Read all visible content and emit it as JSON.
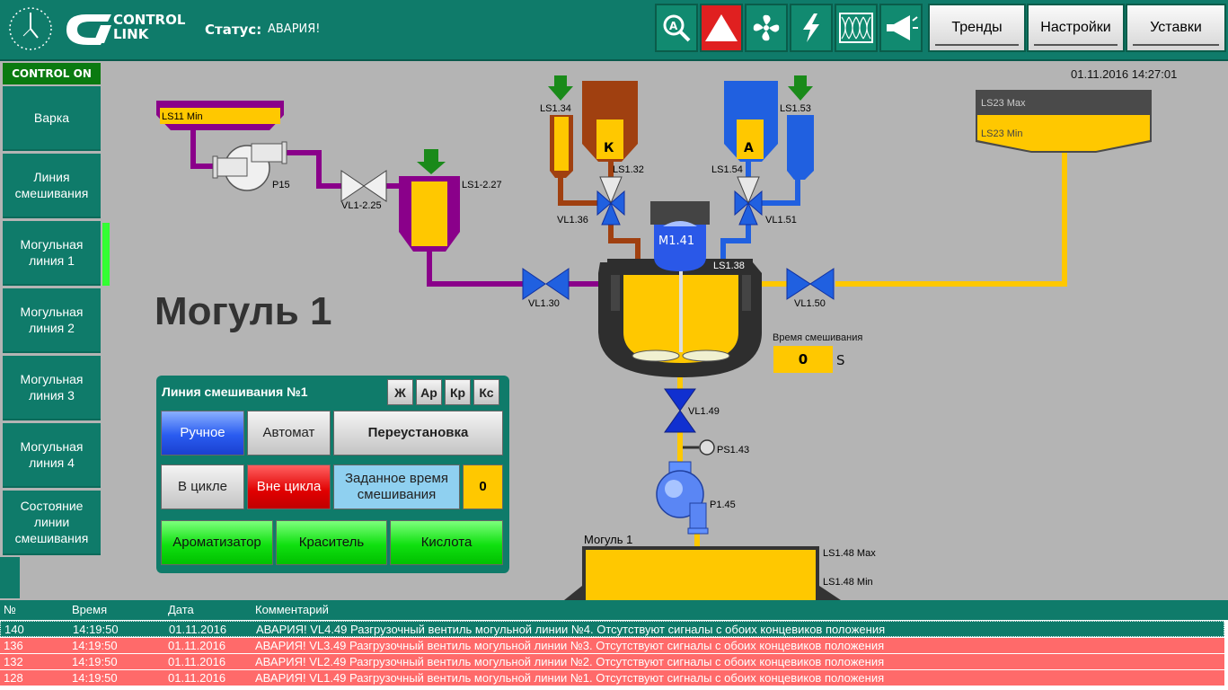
{
  "header": {
    "logo_line1": "CONTROL",
    "logo_line2": "LINK",
    "status_label": "Статус:",
    "status_value": "АВАРИЯ!",
    "icons": [
      "search-zoom-icon",
      "alarm-warning-icon",
      "fan-icon",
      "lightning-icon",
      "pattern-icon",
      "horn-icon"
    ],
    "buttons": {
      "trends": "Тренды",
      "settings": "Настройки",
      "setpoints": "Уставки"
    }
  },
  "sidebar": {
    "header": "CONTROL ON",
    "items": [
      {
        "label": "Варка"
      },
      {
        "label": "Линия смешивания"
      },
      {
        "label": "Могульная линия 1"
      },
      {
        "label": "Могульная линия 2"
      },
      {
        "label": "Могульная линия 3"
      },
      {
        "label": "Могульная линия 4"
      },
      {
        "label": "Состояние линии смешивания"
      }
    ],
    "active_index": 2
  },
  "datetime": "01.11.2016 14:27:01",
  "page_title": "Могуль 1",
  "process": {
    "ls11": "LS11 Min",
    "p15": "P15",
    "vl1_225": "VL1-2.25",
    "ls1_227": "LS1-2.27",
    "ls1_34": "LS1.34",
    "k_letter": "К",
    "ls1_32": "LS1.32",
    "vl1_36": "VL1.36",
    "a_letter": "А",
    "ls1_54": "LS1.54",
    "ls1_53": "LS1.53",
    "vl1_51": "VL1.51",
    "m141": "M1.41",
    "ls1_38": "LS1.38",
    "vl1_30": "VL1.30",
    "vl1_50": "VL1.50",
    "ls23_max": "LS23 Max",
    "ls23_min": "LS23 Min",
    "vl1_49": "VL1.49",
    "ps1_43": "PS1.43",
    "p1_45": "P1.45",
    "mogul_label": "Могуль 1",
    "ls1_48_max": "LS1.48 Max",
    "ls1_48_min": "LS1.48 Min",
    "mix_time_label": "Время смешивания",
    "mix_time_value": "0",
    "mix_time_unit": "S"
  },
  "panel": {
    "title": "Линия смешивания №1",
    "tags": [
      "Ж",
      "Ар",
      "Кр",
      "Кс"
    ],
    "manual": "Ручное",
    "auto": "Автомат",
    "reset": "Переустановка",
    "in_cycle": "В цикле",
    "out_cycle": "Вне цикла",
    "set_time": "Заданное время смешивания",
    "set_time_value": "0",
    "aroma": "Ароматизатор",
    "dye": "Краситель",
    "acid": "Кислота"
  },
  "alarms": {
    "columns": [
      "№",
      "Время",
      "Дата",
      "Комментарий"
    ],
    "rows": [
      {
        "num": "140",
        "time": "14:19:50",
        "date": "01.11.2016",
        "comment": "АВАРИЯ! VL4.49 Разгрузочный вентиль могульной линии №4. Отсутствуют сигналы с обоих концевиков положения"
      },
      {
        "num": "136",
        "time": "14:19:50",
        "date": "01.11.2016",
        "comment": "АВАРИЯ! VL3.49 Разгрузочный вентиль могульной линии №3. Отсутствуют сигналы с обоих концевиков положения"
      },
      {
        "num": "132",
        "time": "14:19:50",
        "date": "01.11.2016",
        "comment": "АВАРИЯ! VL2.49 Разгрузочный вентиль могульной линии №2. Отсутствуют сигналы с обоих концевиков положения"
      },
      {
        "num": "128",
        "time": "14:19:50",
        "date": "01.11.2016",
        "comment": "АВАРИЯ! VL1.49 Разгрузочный вентиль могульной линии №1. Отсутствуют сигналы с обоих концевиков положения"
      }
    ]
  },
  "colors": {
    "teal": "#0f7b6a",
    "alarm_red": "#ff6a6a",
    "product_yellow": "#ffc800",
    "pipe_purple": "#8a008a",
    "pipe_brown": "#a04010",
    "pipe_blue": "#2060e0",
    "active_green": "#33ff33"
  }
}
